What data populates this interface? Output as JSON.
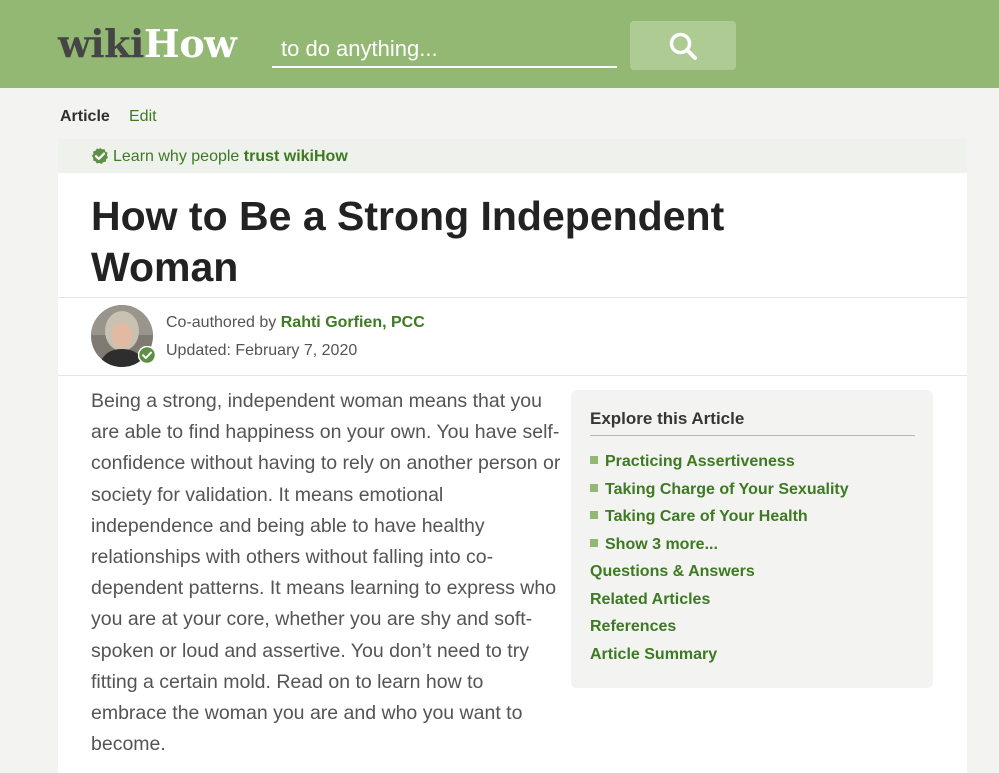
{
  "header": {
    "logo_wiki": "wiki",
    "logo_how": "How",
    "search_placeholder": "to do anything...",
    "search_icon": "search-icon",
    "bg_color": "#93b874"
  },
  "tabs": {
    "article": "Article",
    "edit": "Edit"
  },
  "trust": {
    "prefix": "Learn why people",
    "link": "trust wikiHow",
    "icon": "verified-check-icon"
  },
  "article": {
    "title": "How to Be a Strong Independent Woman",
    "coauthored_label": "Co-authored by",
    "author": "Rahti Gorfien, PCC",
    "updated": "Updated: February 7, 2020",
    "intro": "Being a strong, independent woman means that you are able to find happiness on your own. You have self-confidence without having to rely on another person or society for validation. It means emotional independence and being able to have healthy relationships with others without falling into co-dependent patterns. It means learning to express who you are at your core, whether you are shy and soft-spoken or loud and assertive. You don’t need to try fitting a certain mold. Read on to learn how to embrace the woman you are and who you want to become."
  },
  "explore": {
    "title": "Explore this Article",
    "sections": [
      "Practicing Assertiveness",
      "Taking Charge of Your Sexuality",
      "Taking Care of Your Health",
      "Show 3 more..."
    ],
    "links": [
      "Questions & Answers",
      "Related Articles",
      "References",
      "Article Summary"
    ]
  },
  "colors": {
    "accent_green": "#3d7a22",
    "header_green": "#93b874"
  }
}
